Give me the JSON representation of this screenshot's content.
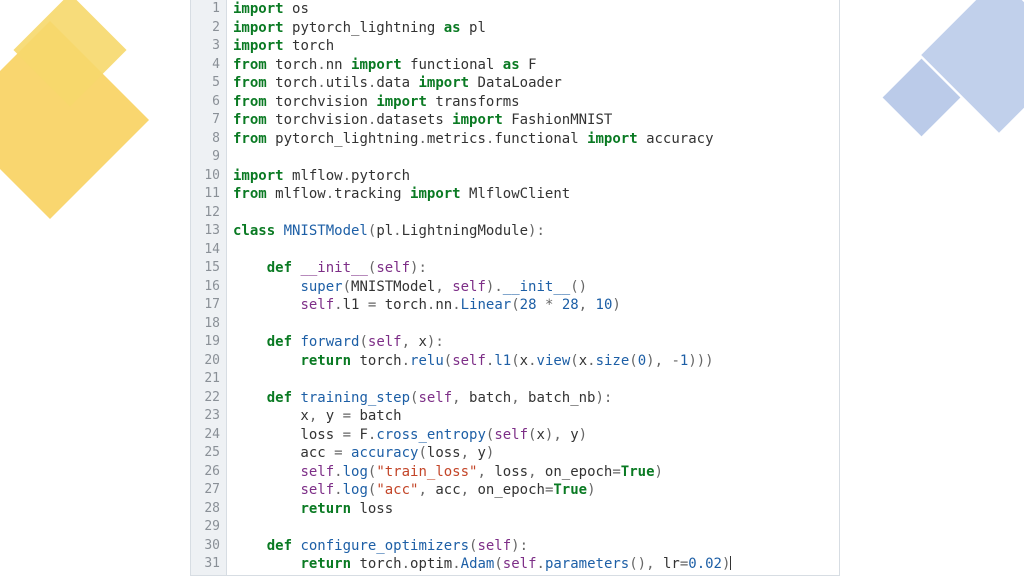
{
  "editor": {
    "title": "code",
    "line_count": 31,
    "lines": [
      {
        "n": 1,
        "raw": "import os",
        "tokens": [
          [
            "kw",
            "import "
          ],
          [
            "name",
            "os"
          ]
        ]
      },
      {
        "n": 2,
        "raw": "import pytorch_lightning as pl",
        "tokens": [
          [
            "kw",
            "import "
          ],
          [
            "name",
            "pytorch_lightning "
          ],
          [
            "kw",
            "as "
          ],
          [
            "name",
            "pl"
          ]
        ]
      },
      {
        "n": 3,
        "raw": "import torch",
        "tokens": [
          [
            "kw",
            "import "
          ],
          [
            "name",
            "torch"
          ]
        ]
      },
      {
        "n": 4,
        "raw": "from torch.nn import functional as F",
        "tokens": [
          [
            "kw",
            "from "
          ],
          [
            "name",
            "torch"
          ],
          [
            "op",
            "."
          ],
          [
            "name",
            "nn "
          ],
          [
            "kw",
            "import "
          ],
          [
            "name",
            "functional "
          ],
          [
            "kw",
            "as "
          ],
          [
            "name",
            "F"
          ]
        ]
      },
      {
        "n": 5,
        "raw": "from torch.utils.data import DataLoader",
        "tokens": [
          [
            "kw",
            "from "
          ],
          [
            "name",
            "torch"
          ],
          [
            "op",
            "."
          ],
          [
            "name",
            "utils"
          ],
          [
            "op",
            "."
          ],
          [
            "name",
            "data "
          ],
          [
            "kw",
            "import "
          ],
          [
            "name",
            "DataLoader"
          ]
        ]
      },
      {
        "n": 6,
        "raw": "from torchvision import transforms",
        "tokens": [
          [
            "kw",
            "from "
          ],
          [
            "name",
            "torchvision "
          ],
          [
            "kw",
            "import "
          ],
          [
            "name",
            "transforms"
          ]
        ]
      },
      {
        "n": 7,
        "raw": "from torchvision.datasets import FashionMNIST",
        "tokens": [
          [
            "kw",
            "from "
          ],
          [
            "name",
            "torchvision"
          ],
          [
            "op",
            "."
          ],
          [
            "name",
            "datasets "
          ],
          [
            "kw",
            "import "
          ],
          [
            "name",
            "FashionMNIST"
          ]
        ]
      },
      {
        "n": 8,
        "raw": "from pytorch_lightning.metrics.functional import accuracy",
        "tokens": [
          [
            "kw",
            "from "
          ],
          [
            "name",
            "pytorch_lightning"
          ],
          [
            "op",
            "."
          ],
          [
            "name",
            "metrics"
          ],
          [
            "op",
            "."
          ],
          [
            "name",
            "functional "
          ],
          [
            "kw",
            "import "
          ],
          [
            "name",
            "accuracy"
          ]
        ]
      },
      {
        "n": 9,
        "raw": "",
        "tokens": []
      },
      {
        "n": 10,
        "raw": "import mlflow.pytorch",
        "tokens": [
          [
            "kw",
            "import "
          ],
          [
            "name",
            "mlflow"
          ],
          [
            "op",
            "."
          ],
          [
            "name",
            "pytorch"
          ]
        ]
      },
      {
        "n": 11,
        "raw": "from mlflow.tracking import MlflowClient",
        "tokens": [
          [
            "kw",
            "from "
          ],
          [
            "name",
            "mlflow"
          ],
          [
            "op",
            "."
          ],
          [
            "name",
            "tracking "
          ],
          [
            "kw",
            "import "
          ],
          [
            "name",
            "MlflowClient"
          ]
        ]
      },
      {
        "n": 12,
        "raw": "",
        "tokens": []
      },
      {
        "n": 13,
        "raw": "class MNISTModel(pl.LightningModule):",
        "tokens": [
          [
            "kw",
            "class "
          ],
          [
            "cls",
            "MNISTModel"
          ],
          [
            "op",
            "("
          ],
          [
            "name",
            "pl"
          ],
          [
            "op",
            "."
          ],
          [
            "name",
            "LightningModule"
          ],
          [
            "op",
            "):"
          ]
        ]
      },
      {
        "n": 14,
        "raw": "",
        "tokens": []
      },
      {
        "n": 15,
        "raw": "    def __init__(self):",
        "tokens": [
          [
            "name",
            "    "
          ],
          [
            "kw",
            "def "
          ],
          [
            "dun",
            "__init__"
          ],
          [
            "op",
            "("
          ],
          [
            "self",
            "self"
          ],
          [
            "op",
            "):"
          ]
        ]
      },
      {
        "n": 16,
        "raw": "        super(MNISTModel, self).__init__()",
        "tokens": [
          [
            "name",
            "        "
          ],
          [
            "fn",
            "super"
          ],
          [
            "op",
            "("
          ],
          [
            "name",
            "MNISTModel"
          ],
          [
            "op",
            ", "
          ],
          [
            "self",
            "self"
          ],
          [
            "op",
            ")."
          ],
          [
            "fn",
            "__init__"
          ],
          [
            "op",
            "()"
          ]
        ]
      },
      {
        "n": 17,
        "raw": "        self.l1 = torch.nn.Linear(28 * 28, 10)",
        "tokens": [
          [
            "name",
            "        "
          ],
          [
            "self",
            "self"
          ],
          [
            "op",
            "."
          ],
          [
            "name",
            "l1 "
          ],
          [
            "op",
            "= "
          ],
          [
            "name",
            "torch"
          ],
          [
            "op",
            "."
          ],
          [
            "name",
            "nn"
          ],
          [
            "op",
            "."
          ],
          [
            "fn",
            "Linear"
          ],
          [
            "op",
            "("
          ],
          [
            "num",
            "28"
          ],
          [
            "op",
            " * "
          ],
          [
            "num",
            "28"
          ],
          [
            "op",
            ", "
          ],
          [
            "num",
            "10"
          ],
          [
            "op",
            ")"
          ]
        ]
      },
      {
        "n": 18,
        "raw": "",
        "tokens": []
      },
      {
        "n": 19,
        "raw": "    def forward(self, x):",
        "tokens": [
          [
            "name",
            "    "
          ],
          [
            "kw",
            "def "
          ],
          [
            "def",
            "forward"
          ],
          [
            "op",
            "("
          ],
          [
            "self",
            "self"
          ],
          [
            "op",
            ", "
          ],
          [
            "name",
            "x"
          ],
          [
            "op",
            "):"
          ]
        ]
      },
      {
        "n": 20,
        "raw": "        return torch.relu(self.l1(x.view(x.size(0), -1)))",
        "tokens": [
          [
            "name",
            "        "
          ],
          [
            "kw",
            "return "
          ],
          [
            "name",
            "torch"
          ],
          [
            "op",
            "."
          ],
          [
            "fn",
            "relu"
          ],
          [
            "op",
            "("
          ],
          [
            "self",
            "self"
          ],
          [
            "op",
            "."
          ],
          [
            "fn",
            "l1"
          ],
          [
            "op",
            "("
          ],
          [
            "name",
            "x"
          ],
          [
            "op",
            "."
          ],
          [
            "fn",
            "view"
          ],
          [
            "op",
            "("
          ],
          [
            "name",
            "x"
          ],
          [
            "op",
            "."
          ],
          [
            "fn",
            "size"
          ],
          [
            "op",
            "("
          ],
          [
            "num",
            "0"
          ],
          [
            "op",
            "), "
          ],
          [
            "op",
            "-"
          ],
          [
            "num",
            "1"
          ],
          [
            "op",
            ")))"
          ]
        ]
      },
      {
        "n": 21,
        "raw": "",
        "tokens": []
      },
      {
        "n": 22,
        "raw": "    def training_step(self, batch, batch_nb):",
        "tokens": [
          [
            "name",
            "    "
          ],
          [
            "kw",
            "def "
          ],
          [
            "def",
            "training_step"
          ],
          [
            "op",
            "("
          ],
          [
            "self",
            "self"
          ],
          [
            "op",
            ", "
          ],
          [
            "name",
            "batch"
          ],
          [
            "op",
            ", "
          ],
          [
            "name",
            "batch_nb"
          ],
          [
            "op",
            "):"
          ]
        ]
      },
      {
        "n": 23,
        "raw": "        x, y = batch",
        "tokens": [
          [
            "name",
            "        x"
          ],
          [
            "op",
            ", "
          ],
          [
            "name",
            "y "
          ],
          [
            "op",
            "= "
          ],
          [
            "name",
            "batch"
          ]
        ]
      },
      {
        "n": 24,
        "raw": "        loss = F.cross_entropy(self(x), y)",
        "tokens": [
          [
            "name",
            "        loss "
          ],
          [
            "op",
            "= "
          ],
          [
            "name",
            "F"
          ],
          [
            "op",
            "."
          ],
          [
            "fn",
            "cross_entropy"
          ],
          [
            "op",
            "("
          ],
          [
            "self",
            "self"
          ],
          [
            "op",
            "("
          ],
          [
            "name",
            "x"
          ],
          [
            "op",
            "), "
          ],
          [
            "name",
            "y"
          ],
          [
            "op",
            ")"
          ]
        ]
      },
      {
        "n": 25,
        "raw": "        acc = accuracy(loss, y)",
        "tokens": [
          [
            "name",
            "        acc "
          ],
          [
            "op",
            "= "
          ],
          [
            "fn",
            "accuracy"
          ],
          [
            "op",
            "("
          ],
          [
            "name",
            "loss"
          ],
          [
            "op",
            ", "
          ],
          [
            "name",
            "y"
          ],
          [
            "op",
            ")"
          ]
        ]
      },
      {
        "n": 26,
        "raw": "        self.log(\"train_loss\", loss, on_epoch=True)",
        "tokens": [
          [
            "name",
            "        "
          ],
          [
            "self",
            "self"
          ],
          [
            "op",
            "."
          ],
          [
            "fn",
            "log"
          ],
          [
            "op",
            "("
          ],
          [
            "str",
            "\"train_loss\""
          ],
          [
            "op",
            ", "
          ],
          [
            "name",
            "loss"
          ],
          [
            "op",
            ", "
          ],
          [
            "name",
            "on_epoch"
          ],
          [
            "op",
            "="
          ],
          [
            "bool",
            "True"
          ],
          [
            "op",
            ")"
          ]
        ]
      },
      {
        "n": 27,
        "raw": "        self.log(\"acc\", acc, on_epoch=True)",
        "tokens": [
          [
            "name",
            "        "
          ],
          [
            "self",
            "self"
          ],
          [
            "op",
            "."
          ],
          [
            "fn",
            "log"
          ],
          [
            "op",
            "("
          ],
          [
            "str",
            "\"acc\""
          ],
          [
            "op",
            ", "
          ],
          [
            "name",
            "acc"
          ],
          [
            "op",
            ", "
          ],
          [
            "name",
            "on_epoch"
          ],
          [
            "op",
            "="
          ],
          [
            "bool",
            "True"
          ],
          [
            "op",
            ")"
          ]
        ]
      },
      {
        "n": 28,
        "raw": "        return loss",
        "tokens": [
          [
            "name",
            "        "
          ],
          [
            "kw",
            "return "
          ],
          [
            "name",
            "loss"
          ]
        ]
      },
      {
        "n": 29,
        "raw": "",
        "tokens": []
      },
      {
        "n": 30,
        "raw": "    def configure_optimizers(self):",
        "tokens": [
          [
            "name",
            "    "
          ],
          [
            "kw",
            "def "
          ],
          [
            "def",
            "configure_optimizers"
          ],
          [
            "op",
            "("
          ],
          [
            "self",
            "self"
          ],
          [
            "op",
            "):"
          ]
        ]
      },
      {
        "n": 31,
        "raw": "        return torch.optim.Adam(self.parameters(), lr=0.02)",
        "tokens": [
          [
            "name",
            "        "
          ],
          [
            "kw",
            "return "
          ],
          [
            "name",
            "torch"
          ],
          [
            "op",
            "."
          ],
          [
            "name",
            "optim"
          ],
          [
            "op",
            "."
          ],
          [
            "fn",
            "Adam"
          ],
          [
            "op",
            "("
          ],
          [
            "self",
            "self"
          ],
          [
            "op",
            "."
          ],
          [
            "fn",
            "parameters"
          ],
          [
            "op",
            "(), "
          ],
          [
            "name",
            "lr"
          ],
          [
            "op",
            "="
          ],
          [
            "num",
            "0.02"
          ],
          [
            "op",
            ")"
          ]
        ]
      }
    ]
  }
}
